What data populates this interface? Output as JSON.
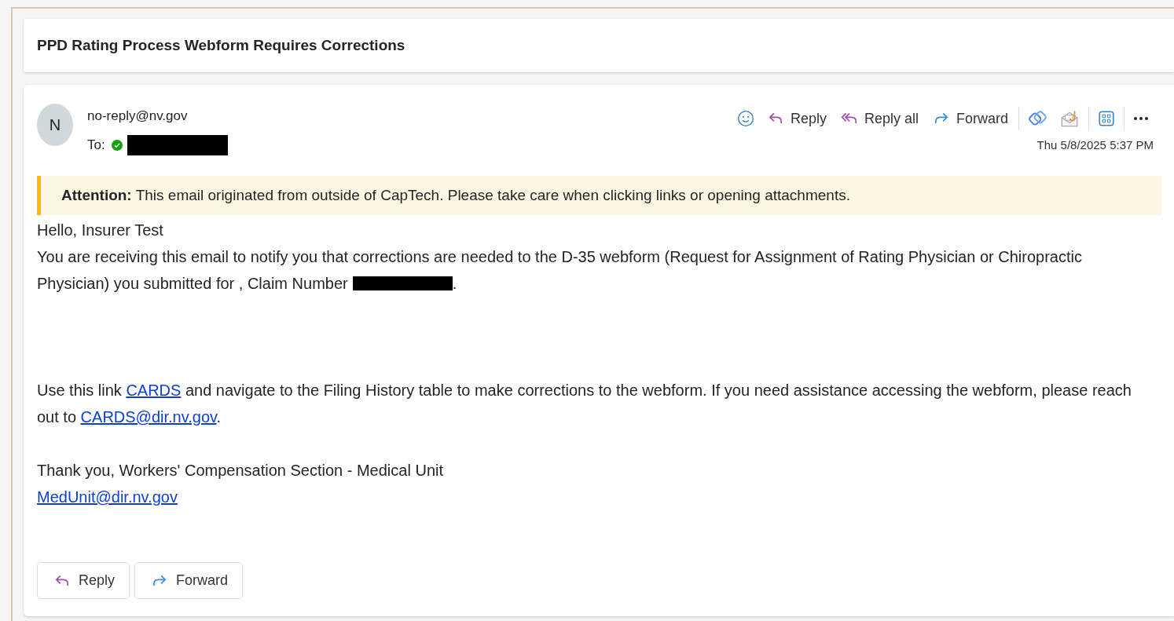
{
  "subject": "PPD Rating Process Webform Requires Corrections",
  "sender": {
    "initial": "N",
    "email": "no-reply@nv.gov",
    "to_label": "To:",
    "verified": true
  },
  "toolbar": [
    {
      "kind": "emoji"
    },
    {
      "kind": "reply",
      "label": "Reply"
    },
    {
      "kind": "reply_all",
      "label": "Reply all"
    },
    {
      "kind": "forward",
      "label": "Forward"
    },
    {
      "kind": "viva"
    },
    {
      "kind": "phish"
    },
    {
      "kind": "apps"
    },
    {
      "kind": "more"
    }
  ],
  "date": "Thu 5/8/2025 5:37 PM",
  "banner": "**Attention:** This email originated from outside of CapTech. Please take care when clicking links or opening attachments.",
  "body": [
    {
      "segments": [
        {
          "kind": "text",
          "text": "Hello, Insurer Test"
        }
      ]
    },
    {
      "segments": [
        {
          "kind": "text",
          "text": "You are receiving this email to notify you that corrections are needed to the D-35 webform (Request for Assignment of Rating Physician or Chiropractic Physician) you submitted for , Claim Number"
        },
        {
          "kind": "redacted"
        },
        {
          "kind": "text",
          "text": "."
        }
      ]
    },
    {
      "segments": [
        {
          "kind": "text",
          "text": "Use this link "
        },
        {
          "kind": "link",
          "text": "CARDS"
        },
        {
          "kind": "text",
          "text": " and navigate to the Filing History table to make corrections to the webform. If you need assistance accessing the webform, please reach out to "
        },
        {
          "kind": "link",
          "text": "CARDS@dir.nv.gov"
        },
        {
          "kind": "text",
          "text": "."
        }
      ]
    },
    {
      "segments": [
        {
          "kind": "text",
          "text": "Thank you, Workers' Compensation Section - Medical Unit"
        }
      ]
    },
    {
      "segments": [
        {
          "kind": "link",
          "text": "MedUnit@dir.nv.gov"
        }
      ]
    }
  ],
  "footer_buttons": [
    {
      "kind": "reply",
      "label": "Reply"
    },
    {
      "kind": "forward",
      "label": "Forward"
    }
  ]
}
